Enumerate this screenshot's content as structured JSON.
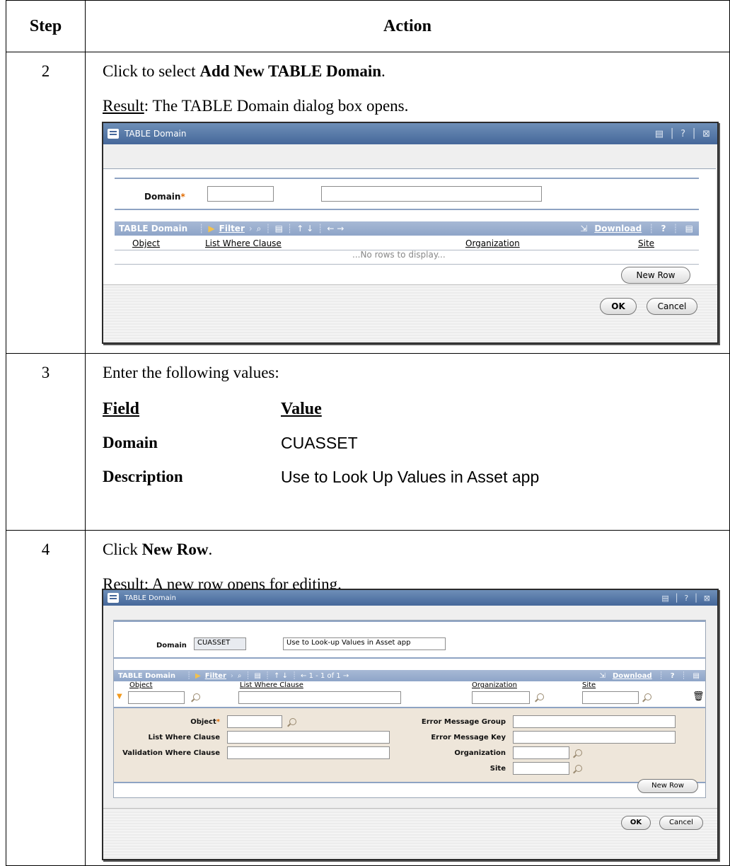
{
  "table": {
    "headers": {
      "step": "Step",
      "action": "Action"
    },
    "rows": {
      "r2": {
        "step": "2",
        "line1_pre": "Click to select ",
        "line1_bold": "Add New TABLE Domain",
        "line1_post": ".",
        "result_label": "Result",
        "result_text": ": The TABLE Domain dialog box opens."
      },
      "r3": {
        "step": "3",
        "intro": "Enter the following values:",
        "field_header": "Field",
        "value_header": "Value",
        "fields": [
          {
            "field": "Domain",
            "value": "CUASSET"
          },
          {
            "field": "Description",
            "value": "Use to Look Up Values in Asset app"
          }
        ]
      },
      "r4": {
        "step": "4",
        "line1_pre": "Click ",
        "line1_bold": "New Row",
        "line1_post": ".",
        "result_label": "Result",
        "result_text": ": A new row opens for editing."
      }
    }
  },
  "dialog1": {
    "title": "TABLE Domain",
    "controls": "▤ │ ? │ ⊠",
    "domain_label": "Domain",
    "domain_value": "",
    "description_value": "",
    "grid_title": "TABLE Domain",
    "filter": "Filter",
    "download": "Download",
    "help": "?",
    "columns": [
      "Object",
      "List Where Clause",
      "Organization",
      "Site"
    ],
    "no_rows": "...No rows to display...",
    "new_row": "New Row",
    "ok": "OK",
    "cancel": "Cancel"
  },
  "dialog2": {
    "title": "TABLE Domain",
    "controls": "▤ │ ? │ ⊠",
    "domain_label": "Domain",
    "domain_value": "CUASSET",
    "description_value": "Use to Look-up Values in Asset app",
    "grid_title": "TABLE Domain",
    "filter": "Filter",
    "paging": "1 - 1 of 1",
    "download": "Download",
    "help": "?",
    "columns": [
      "Object",
      "List Where Clause",
      "Organization",
      "Site"
    ],
    "detail_labels": {
      "object": "Object",
      "list_where": "List Where Clause",
      "validation_where": "Validation Where Clause",
      "err_group": "Error Message Group",
      "err_key": "Error Message Key",
      "organization": "Organization",
      "site": "Site"
    },
    "new_row": "New Row",
    "ok": "OK",
    "cancel": "Cancel"
  }
}
